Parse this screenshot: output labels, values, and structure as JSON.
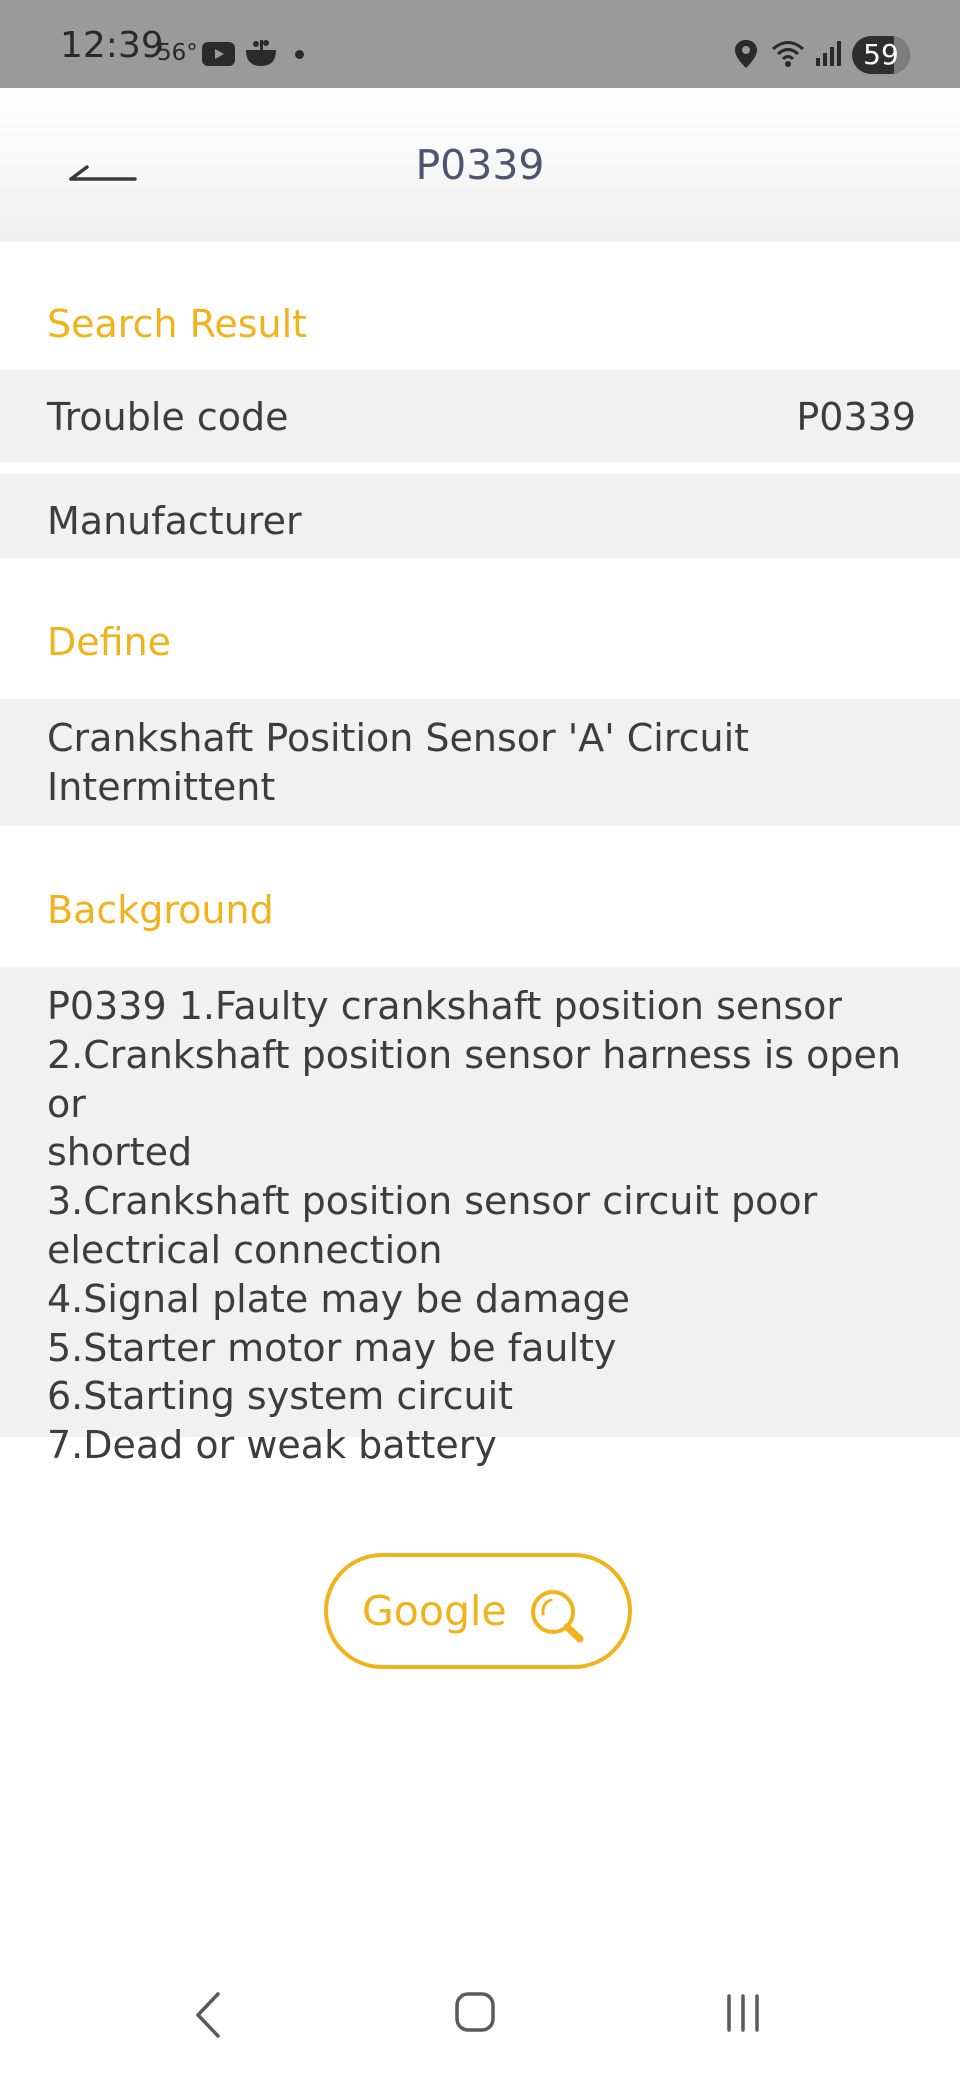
{
  "status_bar": {
    "time": "12:39",
    "temperature": "56°",
    "battery": "59",
    "icons": [
      "youtube-icon",
      "app-notification-icon",
      "location-icon",
      "wifi-icon",
      "signal-icon",
      "battery-icon"
    ]
  },
  "app_bar": {
    "title": "P0339",
    "back_icon": "back-arrow-icon"
  },
  "search_result": {
    "section_title": "Search Result",
    "trouble_code_label": "Trouble code",
    "trouble_code_value": "P0339",
    "manufacturer_label": "Manufacturer"
  },
  "define": {
    "section_title": "Define",
    "text": "Crankshaft Position Sensor 'A' Circuit\nIntermittent"
  },
  "background": {
    "section_title": "Background",
    "text": "P0339 1.Faulty crankshaft position sensor\n2.Crankshaft position sensor harness is open or\nshorted\n3.Crankshaft position sensor circuit poor\nelectrical connection\n4.Signal plate may be damage\n5.Starter motor may be faulty\n6.Starting system circuit\n7.Dead or weak battery"
  },
  "google_button": {
    "label": "Google",
    "icon": "search-icon"
  },
  "colors": {
    "accent": "#f1b21c",
    "title_text": "#4d5570",
    "row_background": "#f1f1f1",
    "status_bar": "#9a9a9a"
  }
}
